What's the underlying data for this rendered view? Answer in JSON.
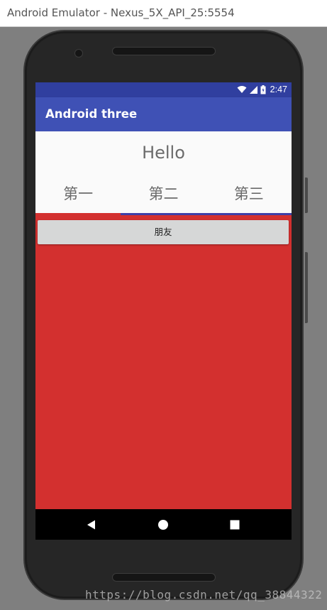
{
  "window": {
    "title": "Android Emulator - Nexus_5X_API_25:5554"
  },
  "status_bar": {
    "time": "2:47",
    "icons": [
      "wifi-icon",
      "signal-icon",
      "battery-icon"
    ]
  },
  "app_bar": {
    "title": "Android three"
  },
  "content": {
    "hello_text": "Hello",
    "tabs": [
      {
        "label": "第一",
        "selected": false
      },
      {
        "label": "第二",
        "selected": true
      },
      {
        "label": "第三",
        "selected": false
      }
    ],
    "button_label": "朋友"
  },
  "nav_bar": {
    "buttons": [
      "back-icon",
      "home-icon",
      "recents-icon"
    ]
  },
  "watermark": "https://blog.csdn.net/qq_38844322",
  "colors": {
    "status_bar": "#303f9f",
    "app_bar": "#3f51b5",
    "content_background": "#d3302f",
    "header_background": "#fafafa",
    "tab_indicator": "#3f3fa8",
    "button_background": "#d6d7d7"
  }
}
